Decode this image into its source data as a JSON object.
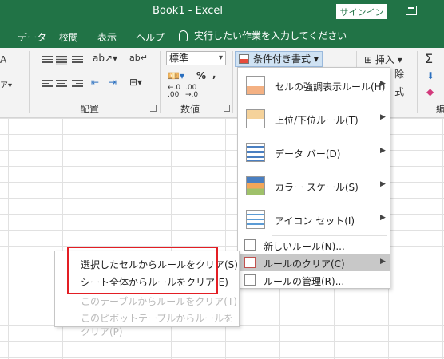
{
  "titlebar": {
    "title": "Book1  -  Excel",
    "signin_label": "サインイン"
  },
  "tabs": [
    "データ",
    "校閲",
    "表示",
    "ヘルプ"
  ],
  "tell_me": "実行したい作業を入力してください",
  "ribbon": {
    "alignment_group": "配置",
    "number_group": "数値",
    "number_format": "標準",
    "percent_symbol": "%",
    "comma_symbol": ",",
    "cf_button_label": "条件付き書式",
    "insert_label": "挿入",
    "sigma_symbol": "Σ",
    "partial_labels": {
      "delete_fragment": "除",
      "format_fragment": "式",
      "edit_fragment": "編"
    }
  },
  "cf_menu": {
    "items": [
      {
        "label": "セルの強調表示ルール(H)",
        "has_submenu": true
      },
      {
        "label": "上位/下位ルール(T)",
        "has_submenu": true
      },
      {
        "label": "データ バー(D)",
        "has_submenu": true
      },
      {
        "label": "カラー スケール(S)",
        "has_submenu": true
      },
      {
        "label": "アイコン セット(I)",
        "has_submenu": true
      }
    ],
    "small_items": [
      {
        "label": "新しいルール(N)..."
      },
      {
        "label": "ルールのクリア(C)",
        "highlighted": true,
        "has_submenu": true
      },
      {
        "label": "ルールの管理(R)..."
      }
    ]
  },
  "clear_submenu": [
    {
      "label": "選択したセルからルールをクリア(S)",
      "enabled": true
    },
    {
      "label": "シート全体からルールをクリア(E)",
      "enabled": true
    },
    {
      "label": "このテーブルからルールをクリア(T)",
      "enabled": false
    },
    {
      "label": "このピボットテーブルからルールをクリア(P)",
      "enabled": false
    }
  ],
  "colors": {
    "excel_green": "#217346",
    "highlight_red": "#e31e24",
    "menu_hover": "#c8c8c8"
  }
}
